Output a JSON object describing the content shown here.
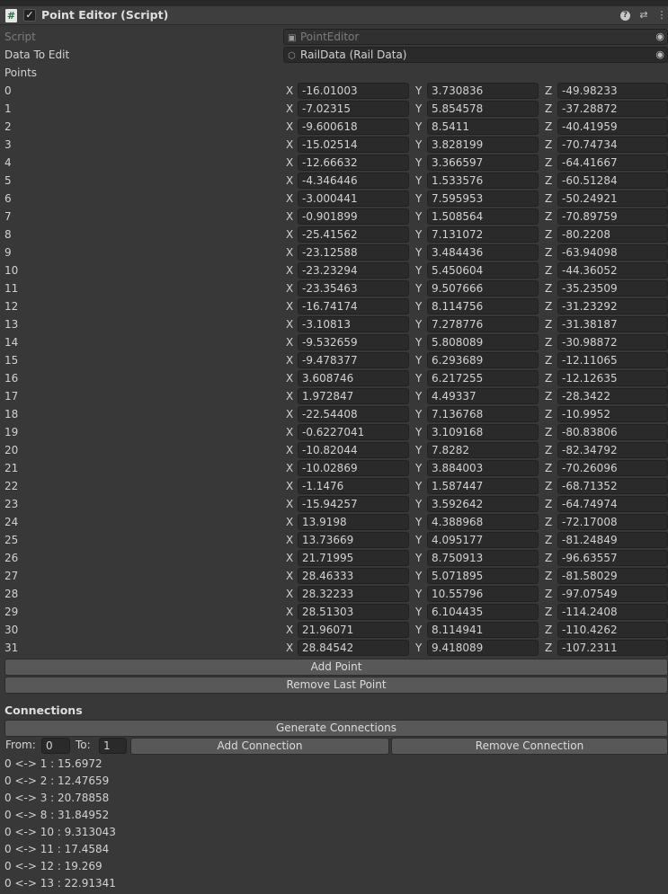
{
  "header": {
    "title": "Point Editor (Script)",
    "enabled_glyph": "✓",
    "script_icon": "hash-script-icon",
    "help_icon": "help-icon",
    "preset_icon": "preset-icon",
    "menu_icon": "kebab-menu-icon"
  },
  "fields": {
    "script_label": "Script",
    "script_value": "PointEditor",
    "data_label": "Data To Edit",
    "data_value": "RailData (Rail Data)",
    "points_label": "Points"
  },
  "axis_labels": {
    "x": "X",
    "y": "Y",
    "z": "Z"
  },
  "points": [
    {
      "index": "0",
      "x": "-16.01003",
      "y": "3.730836",
      "z": "-49.98233"
    },
    {
      "index": "1",
      "x": "-7.02315",
      "y": "5.854578",
      "z": "-37.28872"
    },
    {
      "index": "2",
      "x": "-9.600618",
      "y": "8.5411",
      "z": "-40.41959"
    },
    {
      "index": "3",
      "x": "-15.02514",
      "y": "3.828199",
      "z": "-70.74734"
    },
    {
      "index": "4",
      "x": "-12.66632",
      "y": "3.366597",
      "z": "-64.41667"
    },
    {
      "index": "5",
      "x": "-4.346446",
      "y": "1.533576",
      "z": "-60.51284"
    },
    {
      "index": "6",
      "x": "-3.000441",
      "y": "7.595953",
      "z": "-50.24921"
    },
    {
      "index": "7",
      "x": "-0.901899",
      "y": "1.508564",
      "z": "-70.89759"
    },
    {
      "index": "8",
      "x": "-25.41562",
      "y": "7.131072",
      "z": "-80.2208"
    },
    {
      "index": "9",
      "x": "-23.12588",
      "y": "3.484436",
      "z": "-63.94098"
    },
    {
      "index": "10",
      "x": "-23.23294",
      "y": "5.450604",
      "z": "-44.36052"
    },
    {
      "index": "11",
      "x": "-23.35463",
      "y": "9.507666",
      "z": "-35.23509"
    },
    {
      "index": "12",
      "x": "-16.74174",
      "y": "8.114756",
      "z": "-31.23292"
    },
    {
      "index": "13",
      "x": "-3.10813",
      "y": "7.278776",
      "z": "-31.38187"
    },
    {
      "index": "14",
      "x": "-9.532659",
      "y": "5.808089",
      "z": "-30.98872"
    },
    {
      "index": "15",
      "x": "-9.478377",
      "y": "6.293689",
      "z": "-12.11065"
    },
    {
      "index": "16",
      "x": "3.608746",
      "y": "6.217255",
      "z": "-12.12635"
    },
    {
      "index": "17",
      "x": "1.972847",
      "y": "4.49337",
      "z": "-28.3422"
    },
    {
      "index": "18",
      "x": "-22.54408",
      "y": "7.136768",
      "z": "-10.9952"
    },
    {
      "index": "19",
      "x": "-0.6227041",
      "y": "3.109168",
      "z": "-80.83806"
    },
    {
      "index": "20",
      "x": "-10.82044",
      "y": "7.8282",
      "z": "-82.34792"
    },
    {
      "index": "21",
      "x": "-10.02869",
      "y": "3.884003",
      "z": "-70.26096"
    },
    {
      "index": "22",
      "x": "-1.1476",
      "y": "1.587447",
      "z": "-68.71352"
    },
    {
      "index": "23",
      "x": "-15.94257",
      "y": "3.592642",
      "z": "-64.74974"
    },
    {
      "index": "24",
      "x": "13.9198",
      "y": "4.388968",
      "z": "-72.17008"
    },
    {
      "index": "25",
      "x": "13.73669",
      "y": "4.095177",
      "z": "-81.24849"
    },
    {
      "index": "26",
      "x": "21.71995",
      "y": "8.750913",
      "z": "-96.63557"
    },
    {
      "index": "27",
      "x": "28.46333",
      "y": "5.071895",
      "z": "-81.58029"
    },
    {
      "index": "28",
      "x": "28.32233",
      "y": "10.55796",
      "z": "-97.07549"
    },
    {
      "index": "29",
      "x": "28.51303",
      "y": "6.104435",
      "z": "-114.2408"
    },
    {
      "index": "30",
      "x": "21.96071",
      "y": "8.114941",
      "z": "-110.4262"
    },
    {
      "index": "31",
      "x": "28.84542",
      "y": "9.418089",
      "z": "-107.2311"
    }
  ],
  "buttons": {
    "add_point": "Add Point",
    "remove_last_point": "Remove Last Point",
    "generate_connections": "Generate Connections",
    "add_connection": "Add Connection",
    "remove_connection": "Remove Connection"
  },
  "connections": {
    "title": "Connections",
    "from_label": "From:",
    "from_value": "0",
    "to_label": "To:",
    "to_value": "1",
    "list": [
      "0 <-> 1 : 15.6972",
      "0 <-> 2 : 12.47659",
      "0 <-> 3 : 20.78858",
      "0 <-> 8 : 31.84952",
      "0 <-> 10 : 9.313043",
      "0 <-> 11 : 17.4584",
      "0 <-> 12 : 19.269",
      "0 <-> 13 : 22.91341"
    ]
  }
}
